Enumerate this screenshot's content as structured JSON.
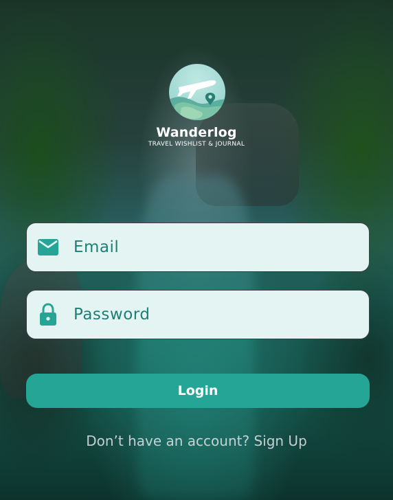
{
  "app": {
    "name": "Wanderlog",
    "tagline": "TRAVEL WISHLIST & JOURNAL",
    "logo_icon": "airplane-map-pin-logo"
  },
  "form": {
    "email": {
      "placeholder": "Email",
      "value": "",
      "icon": "envelope-icon"
    },
    "password": {
      "placeholder": "Password",
      "value": "",
      "icon": "lock-icon"
    },
    "login_label": "Login"
  },
  "footer": {
    "prompt": "Don’t have an account?",
    "signup_label": "Sign Up"
  },
  "colors": {
    "accent": "#24a596",
    "field_bg": "#e3f4f2",
    "field_text": "#1d7f74"
  }
}
